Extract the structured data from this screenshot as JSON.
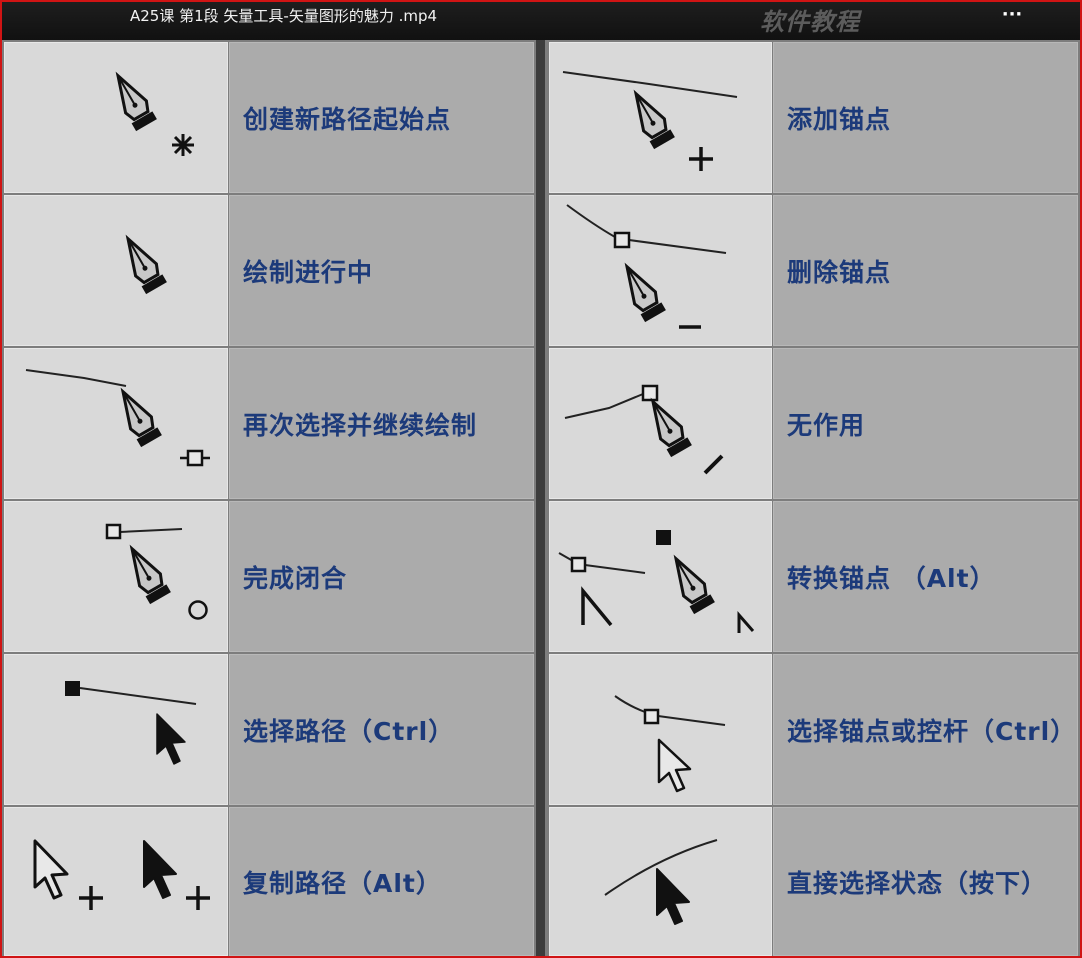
{
  "window": {
    "title": "A25课 第1段 矢量工具-矢量图形的魅力 .mp4",
    "watermark": "软件教程",
    "more_label": "···"
  },
  "left_rows": [
    {
      "icon": "pen-new-path-icon",
      "label": "创建新路径起始点"
    },
    {
      "icon": "pen-drawing-icon",
      "label": "绘制进行中"
    },
    {
      "icon": "pen-continue-icon",
      "label": "再次选择并继续绘制"
    },
    {
      "icon": "pen-close-path-icon",
      "label": "完成闭合"
    },
    {
      "icon": "select-path-icon",
      "label": "选择路径（Ctrl）"
    },
    {
      "icon": "copy-path-icon",
      "label": "复制路径（Alt）"
    }
  ],
  "right_rows": [
    {
      "icon": "pen-add-anchor-icon",
      "label": "添加锚点"
    },
    {
      "icon": "pen-delete-anchor-icon",
      "label": "删除锚点"
    },
    {
      "icon": "pen-no-effect-icon",
      "label": "无作用"
    },
    {
      "icon": "convert-anchor-icon",
      "label": "转换锚点 （Alt）"
    },
    {
      "icon": "select-anchor-icon",
      "label": "选择锚点或控杆（Ctrl）"
    },
    {
      "icon": "direct-select-icon",
      "label": "直接选择状态（按下）"
    }
  ]
}
